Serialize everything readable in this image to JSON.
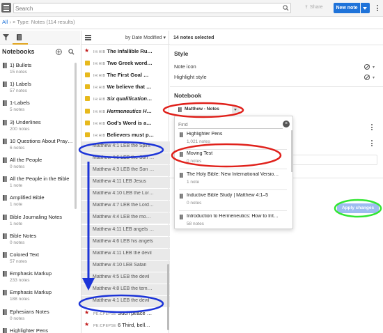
{
  "search": {
    "placeholder": "Search"
  },
  "toolbar": {
    "share_label": "Share",
    "new_note_label": "New note"
  },
  "breadcrumb": {
    "root": "All",
    "separator": "›",
    "filter": "× Type: Notes",
    "results": "(114 results)"
  },
  "sidebar": {
    "title": "Notebooks",
    "items": [
      {
        "title": "1) Bullets",
        "count": "15 notes"
      },
      {
        "title": "1) Labels",
        "count": "57 notes"
      },
      {
        "title": "1-Labels",
        "count": "5 notes"
      },
      {
        "title": "3) Underlines",
        "count": "200 notes"
      },
      {
        "title": "10 Questions About Praye…",
        "count": "6 notes"
      },
      {
        "title": "All the People",
        "count": "0 notes"
      },
      {
        "title": "All the People in the Bible",
        "count": "1 note"
      },
      {
        "title": "Amplified Bible",
        "count": "1 note"
      },
      {
        "title": "Bible Journaling Notes",
        "count": "1 note"
      },
      {
        "title": "Bible Notes",
        "count": "0 notes"
      },
      {
        "title": "Colored Text",
        "count": "57 notes"
      },
      {
        "title": "Emphasis Markup",
        "count": "233 notes"
      },
      {
        "title": "Emphasis Markup",
        "count": "188 notes"
      },
      {
        "title": "Ephesians Notes",
        "count": "0 notes"
      },
      {
        "title": "Highlighter Pens",
        "count": ""
      }
    ]
  },
  "notes_panel": {
    "sort_label": "by Date Modified",
    "notes": [
      {
        "icon": "star",
        "ref": "IH:HIB",
        "text": "The Infallible Ru…",
        "style": "bold",
        "selected": false
      },
      {
        "icon": "square",
        "ref": "IH:HIB",
        "text": "Two Greek word…",
        "style": "bold",
        "selected": false
      },
      {
        "icon": "square",
        "ref": "IH:HIB",
        "text": "The First Goal …",
        "style": "bold",
        "selected": false
      },
      {
        "icon": "square",
        "ref": "IH:HIB",
        "text": "We believe that …",
        "style": "bold",
        "selected": false
      },
      {
        "icon": "square",
        "ref": "IH:HIB",
        "text": "Six qualification…",
        "style": "italic",
        "selected": false
      },
      {
        "icon": "square",
        "ref": "IH:HIB",
        "text": "Hermeneutics H…",
        "style": "italic",
        "selected": false
      },
      {
        "icon": "square",
        "ref": "IH:HIB",
        "text": "God's Word is a…",
        "style": "bold",
        "selected": false
      },
      {
        "icon": "square",
        "ref": "IH:HIB",
        "text": "Believers must p…",
        "style": "bold",
        "selected": false
      },
      {
        "icon": "none",
        "ref": "Matthew 4:1 LEB",
        "text": "the Spirit",
        "style": "light",
        "selected": true
      },
      {
        "icon": "none",
        "ref": "Matthew 4:6 LEB",
        "text": "the Son …",
        "style": "light",
        "selected": true
      },
      {
        "icon": "none",
        "ref": "Matthew 4:3 LEB",
        "text": "the Son …",
        "style": "light",
        "selected": true
      },
      {
        "icon": "none",
        "ref": "Matthew 4:11 LEB",
        "text": "Jesus",
        "style": "light",
        "selected": true
      },
      {
        "icon": "none",
        "ref": "Matthew 4:10 LEB",
        "text": "the Lor…",
        "style": "light",
        "selected": true
      },
      {
        "icon": "none",
        "ref": "Matthew 4:7 LEB",
        "text": "the Lord…",
        "style": "light",
        "selected": true
      },
      {
        "icon": "none",
        "ref": "Matthew 4:4 LEB",
        "text": "the mo…",
        "style": "light",
        "selected": true
      },
      {
        "icon": "none",
        "ref": "Matthew 4:11 LEB",
        "text": "angels …",
        "style": "light",
        "selected": true
      },
      {
        "icon": "none",
        "ref": "Matthew 4:6 LEB",
        "text": "his angels",
        "style": "light",
        "selected": true
      },
      {
        "icon": "none",
        "ref": "Matthew 4:11 LEB",
        "text": "the devil",
        "style": "light",
        "selected": true
      },
      {
        "icon": "none",
        "ref": "Matthew 4:10 LEB",
        "text": "Satan",
        "style": "light",
        "selected": true
      },
      {
        "icon": "none",
        "ref": "Matthew 4:5 LEB",
        "text": "the devil",
        "style": "light",
        "selected": true
      },
      {
        "icon": "none",
        "ref": "Matthew 4:8 LEB",
        "text": "the tem…",
        "style": "light",
        "selected": true
      },
      {
        "icon": "none",
        "ref": "Matthew 4:1 LEB",
        "text": "the devil",
        "style": "light",
        "selected": true
      },
      {
        "icon": "star",
        "ref": "PE:CPEPSE",
        "text": "Such peace …",
        "style": "light",
        "selected": false
      },
      {
        "icon": "star",
        "ref": "PE:CPEPSE",
        "text": "6 Third, bell…",
        "style": "light",
        "selected": false
      }
    ]
  },
  "details": {
    "selected_count": "14 notes selected",
    "style_title": "Style",
    "note_icon_label": "Note icon",
    "highlight_style_label": "Highlight style",
    "notebook_title": "Notebook",
    "notebook_value": "Matthew - Notes",
    "apply_label": "Apply changes"
  },
  "notebook_dropdown": {
    "find_placeholder": "Find",
    "items": [
      {
        "title": "Highlighter Pens",
        "count": "1,021 notes"
      },
      {
        "title": "Moving Test",
        "count": "0 notes"
      },
      {
        "title": "The Holy Bible: New International Versio…",
        "count": "1 note"
      },
      {
        "title": "Inductive Bible Study | Matthew 4:1–5",
        "count": "0 notes"
      },
      {
        "title": "Introduction to Hermeneutics: How to Int…",
        "count": "58 notes"
      }
    ]
  },
  "colors": {
    "accent": "#1f73d9",
    "star": "#c01818",
    "note_square": "#e7b91c",
    "annotation_red": "#e0211b",
    "annotation_blue": "#1c34d8",
    "annotation_green": "#31e631"
  }
}
